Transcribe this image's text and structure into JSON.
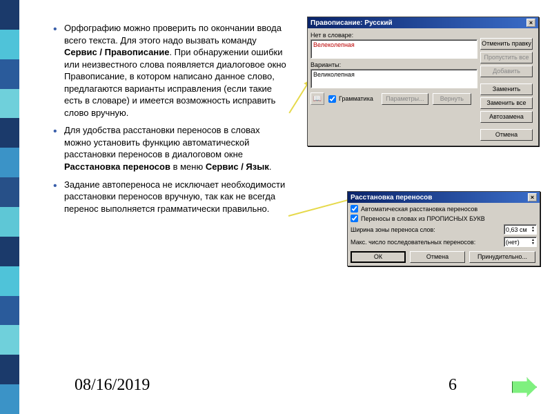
{
  "sidebar_colors": [
    "#1b3a6b",
    "#4fc3d9",
    "#2a5b9b",
    "#6fd0db",
    "#1b3a6b",
    "#3b93c7",
    "#275088",
    "#5ec7d6",
    "#1b3a6b",
    "#4fc3d9",
    "#2a5b9b",
    "#6fd0db",
    "#1b3a6b",
    "#3b93c7"
  ],
  "bullets": [
    {
      "pre": "Орфографию можно проверить по окончании ввода всего текста. Для этого надо вызвать команду ",
      "bold": "Сервис / Правописание",
      "post": ". При обнаружении ошибки или неизвестного слова появляется диалоговое окно Правописание, в котором написано данное слово, предлагаются варианты исправления (если такие есть в словаре) и имеется возможность исправить слово вручную."
    },
    {
      "pre": "Для удобства расстановки переносов в словах можно установить функцию автоматической расстановки переносов в диалоговом окне ",
      "bold": "Расстановка переносов",
      "post": " в меню ",
      "bold2": "Сервис / Язык",
      "post2": "."
    },
    {
      "pre": "Задание автопереноса не исключает необходимости расстановки переносов вручную, так как не всегда перенос выполняется грамматически правильно.",
      "bold": "",
      "post": ""
    }
  ],
  "date": "08/16/2019",
  "page": "6",
  "dlg1": {
    "title": "Правописание: Русский",
    "label_notindict": "Нет в словаре:",
    "wrong_word": "Велеколепная",
    "label_variants": "Варианты:",
    "variant": "Великолепная",
    "btn_undo": "Отменить правку",
    "btn_skipall": "Пропустить все",
    "btn_add": "Добавить",
    "btn_replace": "Заменить",
    "btn_replaceall": "Заменить все",
    "btn_autofix": "Автозамена",
    "check_grammar": "Грамматика",
    "btn_params": "Параметры...",
    "btn_revert": "Вернуть",
    "btn_cancel": "Отмена",
    "book_icon": "📖"
  },
  "dlg2": {
    "title": "Расстановка переносов",
    "chk_auto": "Автоматическая расстановка переносов",
    "chk_caps": "Переносы в словах из ПРОПИСНЫХ БУКВ",
    "lbl_width": "Ширина зоны переноса слов:",
    "val_width": "0,63 см",
    "lbl_max": "Макс. число последовательных переносов:",
    "val_max": "(нет)",
    "btn_ok": "ОК",
    "btn_cancel": "Отмена",
    "btn_force": "Принудительно..."
  }
}
